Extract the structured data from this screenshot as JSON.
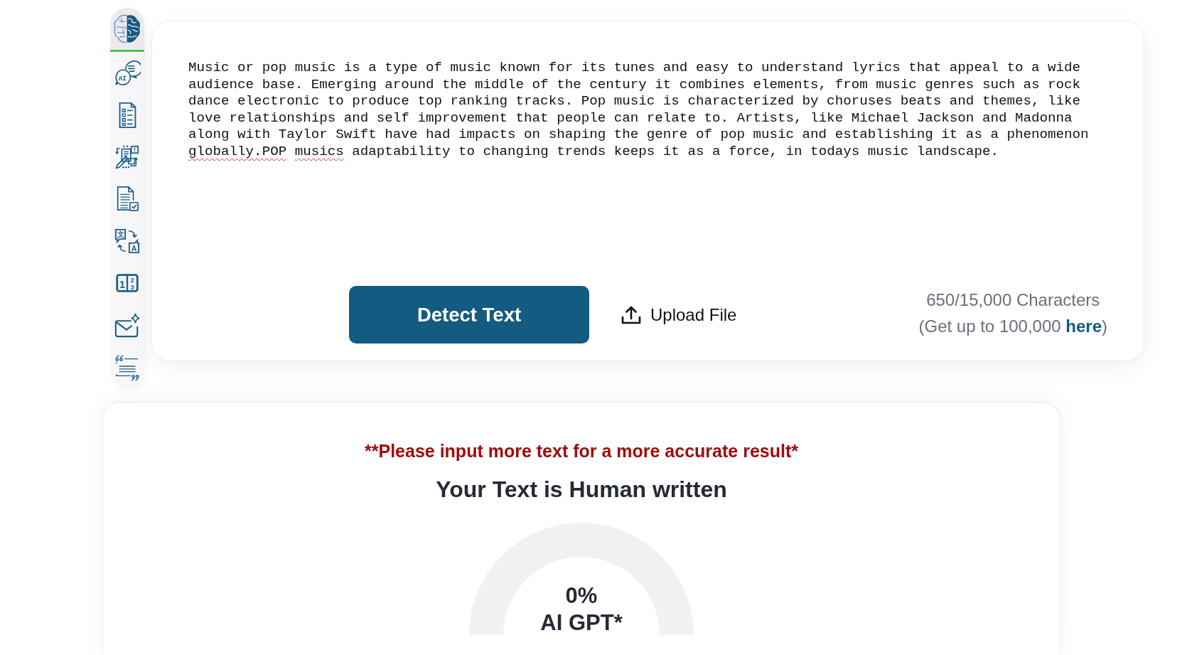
{
  "sidebar": {
    "items": [
      {
        "kind": "brain",
        "selected": true
      },
      {
        "kind": "chat",
        "selected": false,
        "glyphs": [
          "AI"
        ]
      },
      {
        "kind": "checklist",
        "selected": false
      },
      {
        "kind": "diagram",
        "selected": false
      },
      {
        "kind": "doccheck",
        "selected": false
      },
      {
        "kind": "translate",
        "selected": false,
        "glyphs": [
          "文",
          "A"
        ]
      },
      {
        "kind": "numbers",
        "selected": false,
        "glyphs": [
          "1",
          "2",
          "3"
        ]
      },
      {
        "kind": "mail",
        "selected": false
      },
      {
        "kind": "quote",
        "selected": false
      }
    ]
  },
  "editor": {
    "segments": [
      {
        "text": "Music or pop music is a type of music known for its tunes and easy to understand lyrics that appeal to a wide audience base. Emerging around the middle of the century it combines elements, from music genres such as rock dance electronic to produce top ranking tracks. Pop music is characterized by choruses beats and themes, like love relationships and self improvement that people can relate to. Artists, like Michael Jackson and Madonna along with Taylor Swift have had impacts on shaping the genre of pop music and establishing it as a phenomenon ",
        "misspelled": false
      },
      {
        "text": "globally.POP musics",
        "misspelled": true
      },
      {
        "text": " adaptability to changing trends keeps it as a force, in todays music landscape.",
        "misspelled": false
      }
    ]
  },
  "controls": {
    "detect_button": "Detect Text",
    "upload_button": "Upload File",
    "counter": "650/15,000 Characters",
    "limit_note": {
      "before": "(Get up to 100,000 ",
      "link": "here",
      "after": ")"
    }
  },
  "result": {
    "warning": "**Please input more text for a more accurate result*",
    "verdict": "Your Text is Human written",
    "gauge": {
      "value": "0%",
      "label": "AI GPT*"
    }
  }
}
